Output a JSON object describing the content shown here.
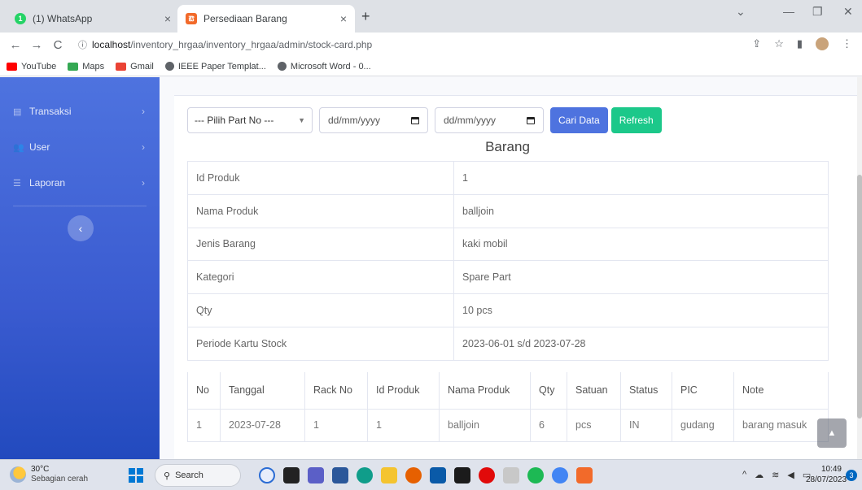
{
  "browser": {
    "tabs": [
      {
        "title": "(1) WhatsApp",
        "active": false
      },
      {
        "title": "Persediaan Barang",
        "active": true
      }
    ],
    "new_tab": "+",
    "url_host": "localhost",
    "url_path": "/inventory_hrgaa/inventory_hrgaa/admin/stock-card.php",
    "bookmarks": [
      {
        "label": "YouTube",
        "color": "#ff0000"
      },
      {
        "label": "Maps",
        "color": "#34a853"
      },
      {
        "label": "Gmail",
        "color": "#ea4335"
      },
      {
        "label": "IEEE Paper Templat...",
        "color": "#5f6368"
      },
      {
        "label": "Microsoft Word - 0...",
        "color": "#5f6368"
      }
    ]
  },
  "sidebar": {
    "items": [
      {
        "label": "Transaksi",
        "icon": "transaction-icon"
      },
      {
        "label": "User",
        "icon": "users-icon"
      },
      {
        "label": "Laporan",
        "icon": "list-icon"
      }
    ],
    "toggle_glyph": "‹"
  },
  "filters": {
    "part_select": "--- Pilih Part No ---",
    "date_from_placeholder": "dd/mm/yyyy",
    "date_to_placeholder": "dd/mm/yyyy",
    "search_button": "Cari Data",
    "refresh_button": "Refresh"
  },
  "section_title": "Barang",
  "product_info": [
    {
      "key": "Id Produk",
      "value": "1"
    },
    {
      "key": "Nama Produk",
      "value": "balljoin"
    },
    {
      "key": "Jenis Barang",
      "value": "kaki mobil"
    },
    {
      "key": "Kategori",
      "value": "Spare Part"
    },
    {
      "key": "Qty",
      "value": "10 pcs"
    },
    {
      "key": "Periode Kartu Stock",
      "value": "2023-06-01 s/d 2023-07-28"
    }
  ],
  "stock_table": {
    "headers": [
      "No",
      "Tanggal",
      "Rack No",
      "Id Produk",
      "Nama Produk",
      "Qty",
      "Satuan",
      "Status",
      "PIC",
      "Note"
    ],
    "rows": [
      [
        "1",
        "2023-07-28",
        "1",
        "1",
        "balljoin",
        "6",
        "pcs",
        "IN",
        "gudang",
        "barang masuk"
      ]
    ]
  },
  "taskbar": {
    "temperature": "30°C",
    "weather": "Sebagian cerah",
    "search_label": "Search",
    "time": "10:49",
    "date": "28/07/2023",
    "notification_count": "3"
  },
  "colors": {
    "sidebar": "#4e73df",
    "primary": "#4e73df",
    "success": "#1cc88a"
  }
}
